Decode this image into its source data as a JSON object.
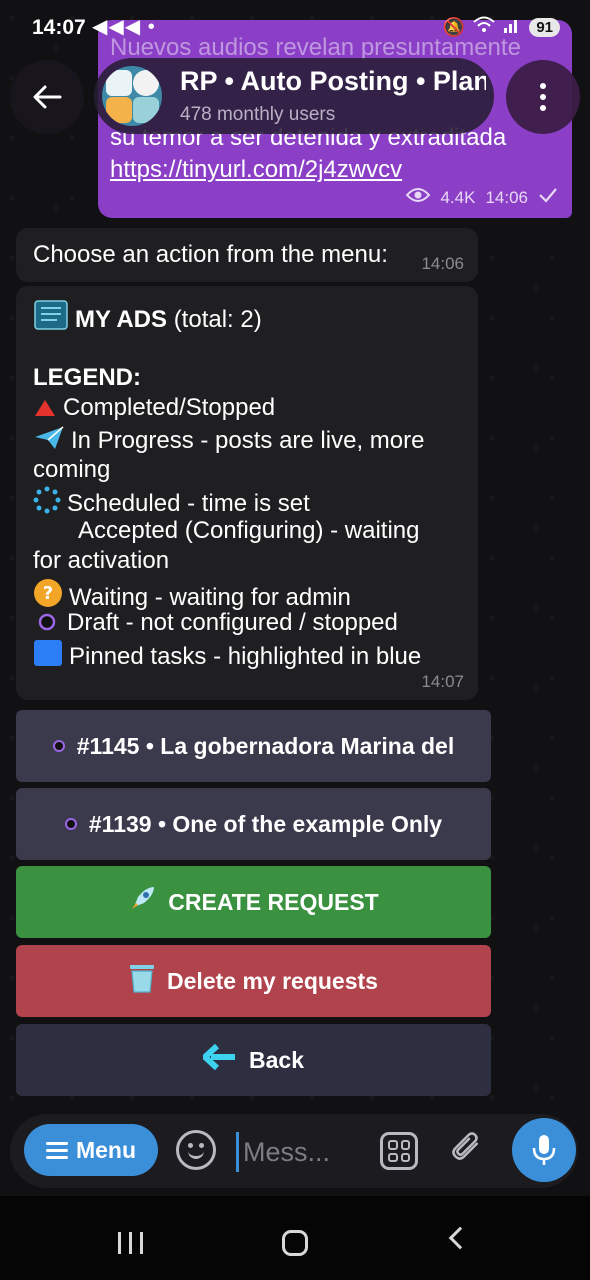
{
  "status_bar": {
    "time": "14:07",
    "left_icons": "◀◀◀ •",
    "battery": "91"
  },
  "channel_post": {
    "line1": "Nuevos audios revelan presuntamente",
    "line3": "su temor a ser detenida y extraditada",
    "link": "https://tinyurl.com/2j4zwvcv",
    "views": "4.4K",
    "time": "14:06"
  },
  "header": {
    "title": "RP • Auto Posting • Plan",
    "subtitle": "478 monthly users"
  },
  "messages": {
    "choose": {
      "text": "Choose an action from the menu:",
      "time": "14:06"
    },
    "ads": {
      "title_bold": "MY ADS",
      "title_rest": "(total: 2)",
      "legend_title": "LEGEND:",
      "legend": {
        "completed": "Completed/Stopped",
        "in_progress_1": "In Progress - posts are live, more",
        "in_progress_2": "coming",
        "scheduled": "Scheduled - time is set",
        "accepted_1": "Accepted (Configuring) - waiting",
        "accepted_2": "for activation",
        "waiting": "Waiting - waiting for admin",
        "draft": "Draft - not configured / stopped",
        "pinned": "Pinned tasks - highlighted in blue"
      },
      "time": "14:07"
    }
  },
  "keyboard": {
    "ad1": "#1145 • La gobernadora Marina del",
    "ad2": "#1139 • One of the example Only",
    "create": "CREATE REQUEST",
    "delete": "Delete my requests",
    "back": "Back"
  },
  "input_bar": {
    "menu_label": "Menu",
    "placeholder": "Mess..."
  },
  "colors": {
    "accent": "#3b8fd8",
    "post_bubble": "#8a3fc6",
    "create_button": "#3a9140",
    "delete_button": "#b0434b"
  }
}
